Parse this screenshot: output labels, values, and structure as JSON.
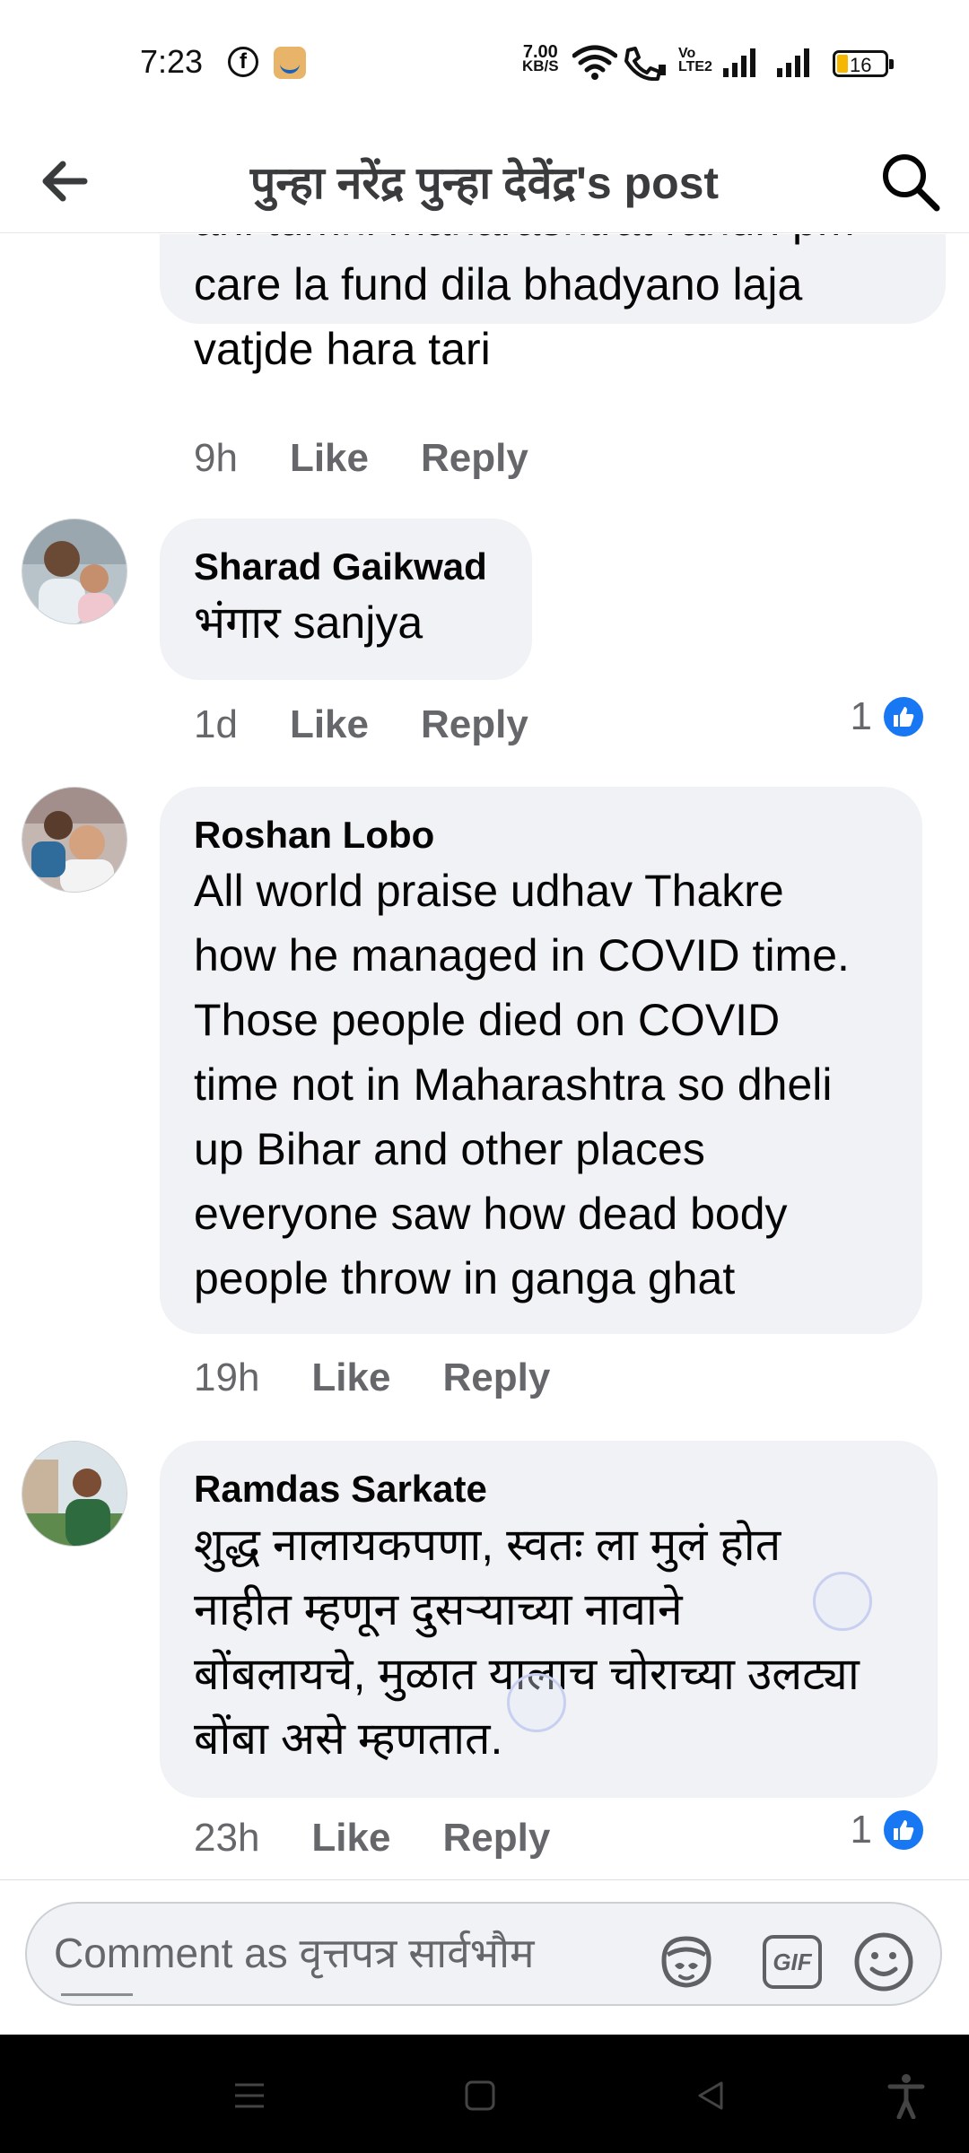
{
  "status_bar": {
    "time": "7:23",
    "net_speed_value": "7.00",
    "net_speed_unit": "KB/S",
    "volte_line1": "Vo",
    "volte_line2": "LTE2",
    "battery_level": "16"
  },
  "header": {
    "title": "पुन्हा नरेंद्र पुन्हा देवेंद्र's post",
    "back_icon": "arrow-left-icon",
    "search_icon": "search-icon"
  },
  "comments": [
    {
      "text_lines": [
        "ani tumhi maharashtrat rahun pm",
        "care la fund dila bhadyano laja",
        "vatjde hara tari"
      ],
      "time": "9h",
      "like_label": "Like",
      "reply_label": "Reply"
    },
    {
      "author": "Sharad Gaikwad",
      "text": "भंगार sanjya",
      "time": "1d",
      "like_label": "Like",
      "reply_label": "Reply",
      "reactions": "1"
    },
    {
      "author": "Roshan Lobo",
      "text_lines": [
        "All world praise udhav Thakre",
        "how he managed in COVID time.",
        "Those people died on COVID",
        "time not in Maharashtra so dheli",
        "up Bihar and other places",
        "everyone saw how dead body",
        "people throw in ganga ghat"
      ],
      "time": "19h",
      "like_label": "Like",
      "reply_label": "Reply"
    },
    {
      "author": "Ramdas Sarkate",
      "text_lines": [
        "शुद्ध नालायकपणा, स्वतः ला मुलं होत",
        "नाहीत म्हणून दुसऱ्याच्या नावाने",
        "बोंबलायचे, मुळात यालाच चोराच्या उलट्या",
        "बोंबा असे म्हणतात."
      ],
      "time": "23h",
      "like_label": "Like",
      "reply_label": "Reply",
      "reactions": "1"
    }
  ],
  "composer": {
    "placeholder": "Comment as वृत्तपत्र सार्वभौम",
    "gif_label": "GIF"
  },
  "colors": {
    "bubble": "#f0f2f5",
    "meta_text": "#65676b",
    "like_blue": "#1877f2"
  }
}
